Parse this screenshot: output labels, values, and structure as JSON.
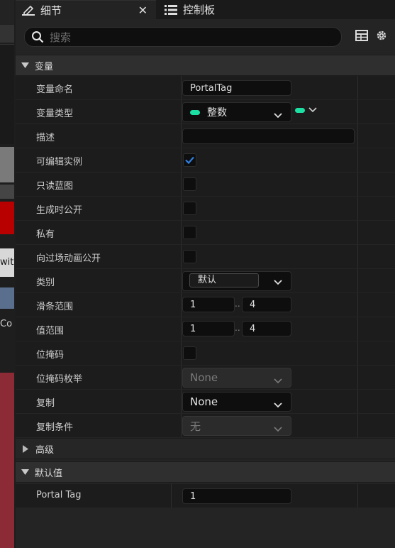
{
  "tabs": [
    {
      "label": "细节"
    },
    {
      "label": "控制板"
    }
  ],
  "search": {
    "placeholder": "搜索"
  },
  "left_strip": {
    "texts": [
      "wit",
      "Co"
    ]
  },
  "sections": {
    "variables": "变量",
    "advanced": "高级",
    "defaults": "默认值"
  },
  "rows": {
    "var_name": {
      "label": "变量命名",
      "value": "PortalTag"
    },
    "var_type": {
      "label": "变量类型",
      "value": "整数",
      "pin_color": "#1ce0a3"
    },
    "description": {
      "label": "描述",
      "value": ""
    },
    "instance_editable": {
      "label": "可编辑实例",
      "checked": true
    },
    "blueprint_readonly": {
      "label": "只读蓝图",
      "checked": false
    },
    "expose_on_spawn": {
      "label": "生成时公开",
      "checked": false
    },
    "private": {
      "label": "私有",
      "checked": false
    },
    "expose_cinematics": {
      "label": "向过场动画公开",
      "checked": false
    },
    "category": {
      "label": "类别",
      "value": "默认"
    },
    "slider_range": {
      "label": "滑条范围",
      "min": "1",
      "separator": "..",
      "max": "4"
    },
    "value_range": {
      "label": "值范围",
      "min": "1",
      "separator": "..",
      "max": "4"
    },
    "bitmask": {
      "label": "位掩码",
      "checked": false
    },
    "bitmask_enum": {
      "label": "位掩码枚举",
      "value": "None"
    },
    "replication": {
      "label": "复制",
      "value": "None"
    },
    "replication_condition": {
      "label": "复制条件",
      "value": "无"
    },
    "portal_tag": {
      "label": "Portal Tag",
      "value": "1"
    }
  },
  "colors": {
    "accent": "#1ce0a3",
    "check": "#2f7fe0"
  }
}
